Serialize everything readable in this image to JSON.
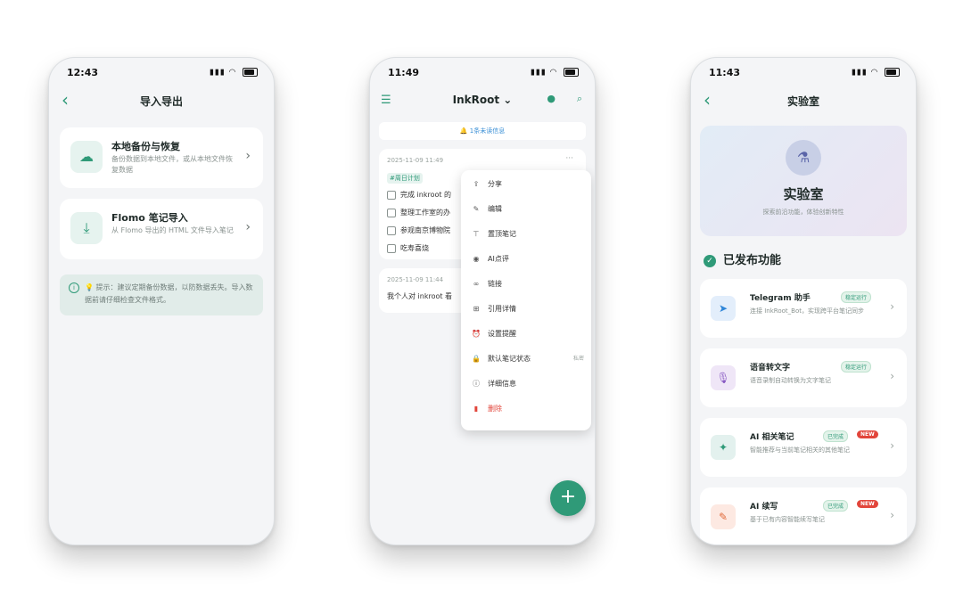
{
  "phone1": {
    "time": "12:43",
    "title": "导入导出",
    "card1": {
      "title": "本地备份与恢复",
      "desc": "备份数据到本地文件，或从本地文件恢复数据"
    },
    "card2": {
      "title": "Flomo 笔记导入",
      "desc": "从 Flomo 导出的 HTML 文件导入笔记"
    },
    "tip": "💡 提示：建议定期备份数据，以防数据丢失。导入数据前请仔细检查文件格式。"
  },
  "phone2": {
    "time": "11:49",
    "title": "InkRoot ⌄",
    "banner": "🔔 1条未读信息",
    "note1": {
      "date": "2025-11-09 11:49",
      "tag": "#周日计划",
      "items": [
        "完成 inkroot 的",
        "整理工作室的办",
        "参观南京博物院",
        "吃寿喜烧"
      ]
    },
    "note2": {
      "date": "2025-11-09 11:44",
      "body": "我个人对 inkroot 看"
    },
    "menu": [
      {
        "label": "分享"
      },
      {
        "label": "编辑"
      },
      {
        "label": "置顶笔记"
      },
      {
        "label": "AI点评"
      },
      {
        "label": "链接"
      },
      {
        "label": "引用详情"
      },
      {
        "label": "设置提醒"
      },
      {
        "label": "默认笔记状态",
        "extra": "私密"
      },
      {
        "label": "详细信息"
      },
      {
        "label": "删除"
      }
    ],
    "fab": "+"
  },
  "phone3": {
    "time": "11:43",
    "title": "实验室",
    "hero": {
      "title": "实验室",
      "subtitle": "探索前沿功能，体验创新特性"
    },
    "section": "已发布功能",
    "features": [
      {
        "title": "Telegram 助手",
        "badge": "稳定运行",
        "desc": "连接 InkRoot_Bot，实现跨平台笔记同步"
      },
      {
        "title": "语音转文字",
        "badge": "稳定运行",
        "desc": "语音录制自动转换为文字笔记"
      },
      {
        "title": "AI 相关笔记",
        "badge": "已完成",
        "badge2": "NEW",
        "desc": "智能推荐与当前笔记相关的其他笔记"
      },
      {
        "title": "AI 续写",
        "badge": "已完成",
        "badge2": "NEW",
        "desc": "基于已有内容智能续写笔记"
      }
    ]
  }
}
